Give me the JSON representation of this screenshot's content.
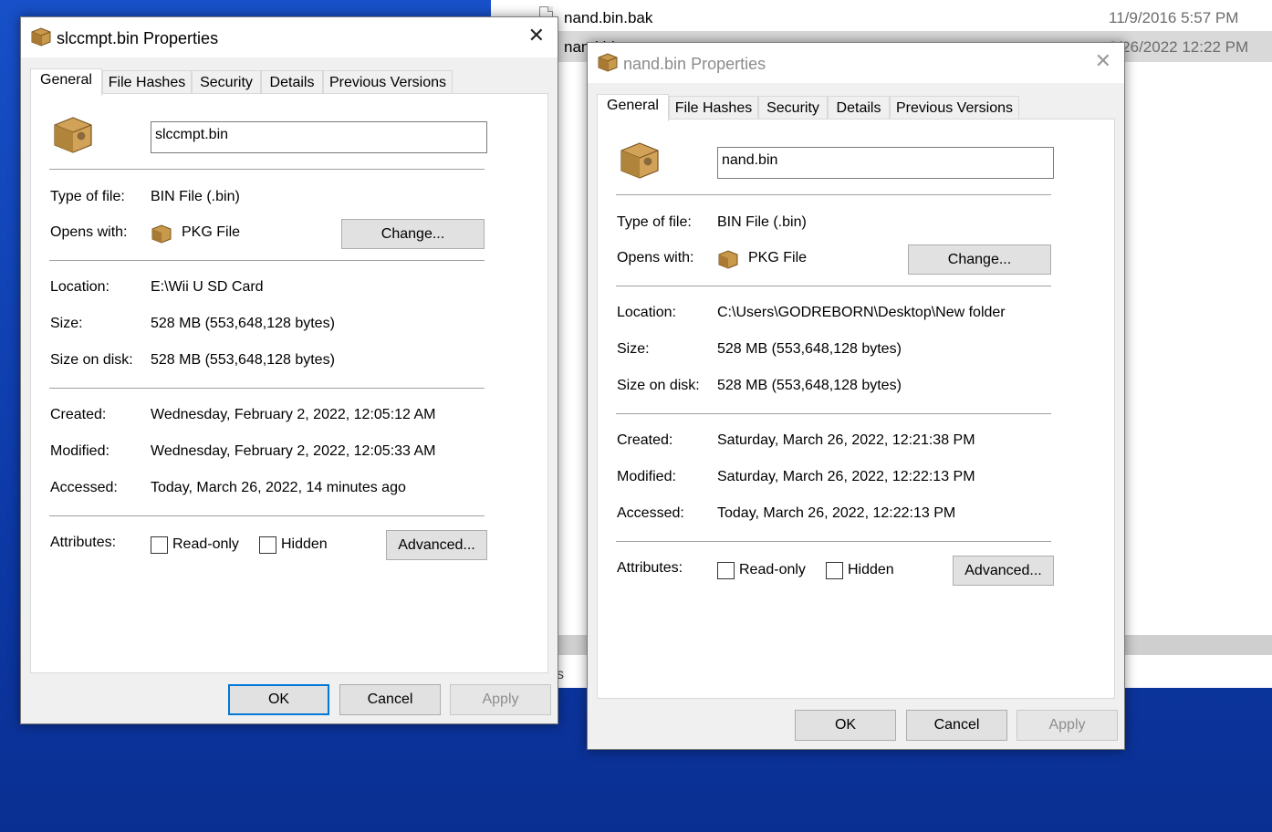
{
  "explorer": {
    "rows": [
      {
        "name": "nand.bin.bak",
        "date": "11/9/2016 5:57 PM"
      },
      {
        "name": "nand.bin",
        "date": "3/26/2022 12:22 PM"
      }
    ],
    "status_fragment": "s"
  },
  "dialog1": {
    "title": "slccmpt.bin Properties",
    "tabs": [
      "General",
      "File Hashes",
      "Security",
      "Details",
      "Previous Versions"
    ],
    "filename": "slccmpt.bin",
    "type_label": "Type of file:",
    "type_value": "BIN File (.bin)",
    "opens_label": "Opens with:",
    "opens_value": "PKG File",
    "change_button": "Change...",
    "location_label": "Location:",
    "location_value": "E:\\Wii U SD Card",
    "size_label": "Size:",
    "size_value": "528 MB (553,648,128 bytes)",
    "size_on_disk_label": "Size on disk:",
    "size_on_disk_value": "528 MB (553,648,128 bytes)",
    "created_label": "Created:",
    "created_value": "Wednesday, February 2, 2022, 12:05:12 AM",
    "modified_label": "Modified:",
    "modified_value": "Wednesday, February 2, 2022, 12:05:33 AM",
    "accessed_label": "Accessed:",
    "accessed_value": "Today, March 26, 2022, 14 minutes ago",
    "attributes_label": "Attributes:",
    "readonly_label": "Read-only",
    "hidden_label": "Hidden",
    "advanced_button": "Advanced...",
    "ok_button": "OK",
    "cancel_button": "Cancel",
    "apply_button": "Apply"
  },
  "dialog2": {
    "title": "nand.bin Properties",
    "tabs": [
      "General",
      "File Hashes",
      "Security",
      "Details",
      "Previous Versions"
    ],
    "filename": "nand.bin",
    "type_label": "Type of file:",
    "type_value": "BIN File (.bin)",
    "opens_label": "Opens with:",
    "opens_value": "PKG File",
    "change_button": "Change...",
    "location_label": "Location:",
    "location_value": "C:\\Users\\GODREBORN\\Desktop\\New folder",
    "size_label": "Size:",
    "size_value": "528 MB (553,648,128 bytes)",
    "size_on_disk_label": "Size on disk:",
    "size_on_disk_value": "528 MB (553,648,128 bytes)",
    "created_label": "Created:",
    "created_value": "Saturday, March 26, 2022, 12:21:38 PM",
    "modified_label": "Modified:",
    "modified_value": "Saturday, March 26, 2022, 12:22:13 PM",
    "accessed_label": "Accessed:",
    "accessed_value": "Today, March 26, 2022, 12:22:13 PM",
    "attributes_label": "Attributes:",
    "readonly_label": "Read-only",
    "hidden_label": "Hidden",
    "advanced_button": "Advanced...",
    "ok_button": "OK",
    "cancel_button": "Cancel",
    "apply_button": "Apply"
  },
  "icons": {
    "window_icon": "package-icon",
    "file_icon": "package-icon",
    "close": "close-icon"
  },
  "colors": {
    "desktop": "#1750c8",
    "focus_border": "#0078d7",
    "selected_row": "#d9d9d9"
  }
}
